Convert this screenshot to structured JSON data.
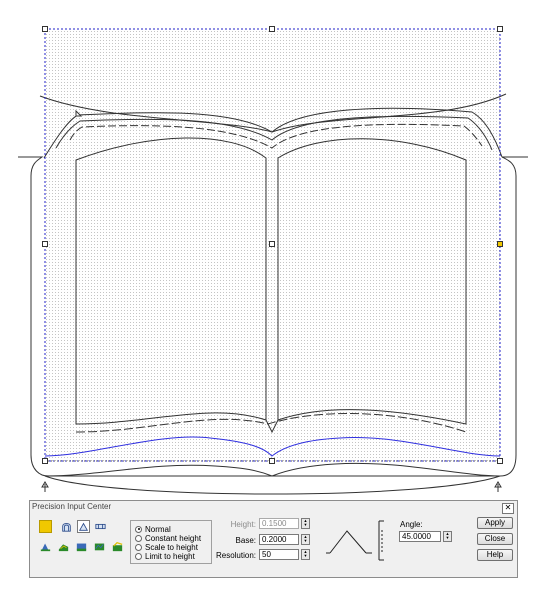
{
  "dialog": {
    "title": "Precision Input Center",
    "close_label": "✕",
    "mode_options": [
      {
        "label": "Normal",
        "selected": true
      },
      {
        "label": "Constant height",
        "selected": false
      },
      {
        "label": "Scale to height",
        "selected": false
      },
      {
        "label": "Limit to height",
        "selected": false
      }
    ],
    "height_label": "Height:",
    "height_value": "0.1500",
    "base_label": "Base:",
    "base_value": "0.2000",
    "resolution_label": "Resolution:",
    "resolution_value": "50",
    "angle_label": "Angle:",
    "angle_value": "45.0000",
    "apply_label": "Apply",
    "close_button_label": "Close",
    "help_label": "Help"
  },
  "colors": {
    "selection_box": "#2020c8",
    "lower_curve": "#3030e0",
    "artwork": "#333333",
    "swatch_yellow": "#f0c800",
    "panel_bg": "#f0f0f0"
  }
}
